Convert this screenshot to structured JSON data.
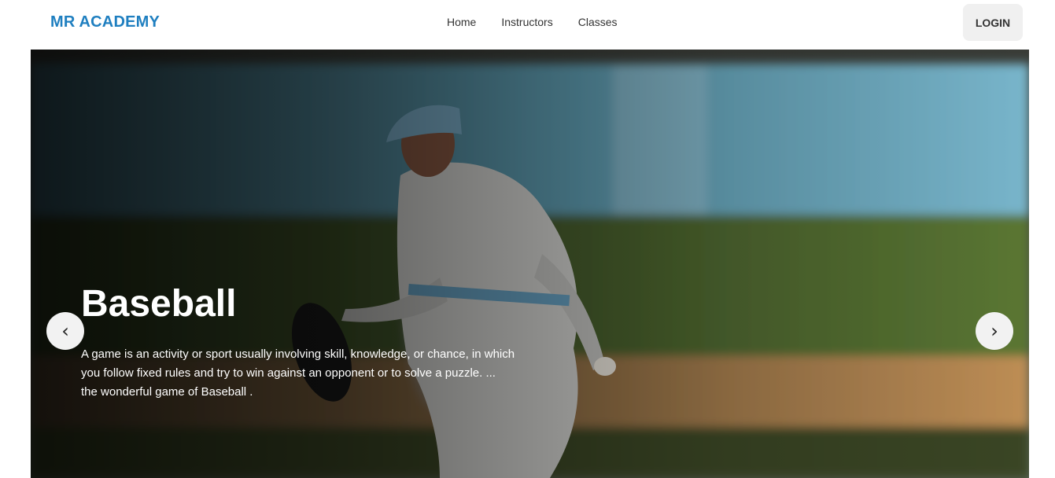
{
  "header": {
    "brand": "MR ACADEMY",
    "nav": [
      "Home",
      "Instructors",
      "Classes"
    ],
    "login_label": "LOGIN"
  },
  "hero": {
    "title": "Baseball",
    "description_lines": [
      "A game is an activity or sport usually involving skill, knowledge, or chance, in which",
      "you follow fixed rules and try to win against an opponent or to solve a puzzle. ...",
      "the wonderful game of Baseball ."
    ],
    "prev_icon": "‹",
    "next_icon": "›"
  },
  "colors": {
    "brand": "#1f7fc0",
    "login_bg": "#f0f0f0",
    "carousel_button_bg": "#f2f2f2"
  }
}
